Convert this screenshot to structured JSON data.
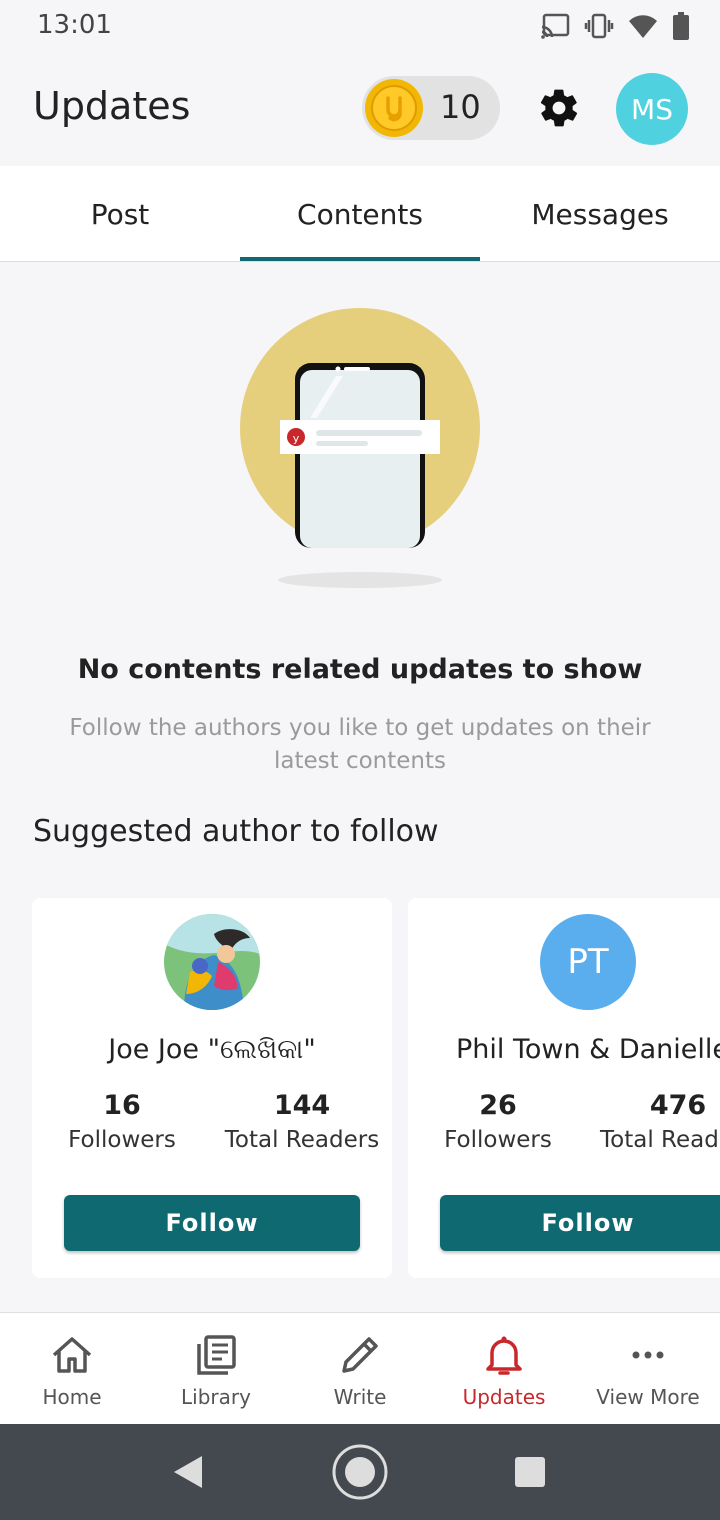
{
  "status_bar": {
    "time": "13:01"
  },
  "header": {
    "title": "Updates",
    "coin_count": "10",
    "avatar_initials": "MS"
  },
  "tabs": [
    {
      "label": "Post"
    },
    {
      "label": "Contents"
    },
    {
      "label": "Messages"
    }
  ],
  "empty_state": {
    "title": "No contents related updates to show",
    "subtitle": "Follow the authors you like to get updates on their latest contents"
  },
  "suggested": {
    "heading": "Suggested author to follow",
    "authors": [
      {
        "name": "Joe Joe \"ଲେଖିକା\"",
        "followers": "16",
        "followers_label": "Followers",
        "readers": "144",
        "readers_label": "Total Readers",
        "button": "Follow"
      },
      {
        "name": "Phil Town & Danielle",
        "initials": "PT",
        "followers": "26",
        "followers_label": "Followers",
        "readers": "476",
        "readers_label": "Total Read",
        "button": "Follow"
      }
    ]
  },
  "bottom_nav": [
    {
      "label": "Home",
      "icon": "home-icon"
    },
    {
      "label": "Library",
      "icon": "library-icon"
    },
    {
      "label": "Write",
      "icon": "pencil-icon"
    },
    {
      "label": "Updates",
      "icon": "bell-icon"
    },
    {
      "label": "View More",
      "icon": "more-icon"
    }
  ],
  "colors": {
    "accent": "#0e6a70",
    "active_nav": "#c8282b",
    "avatar_ms": "#4fd1e0",
    "avatar_pt": "#5aaeee"
  }
}
